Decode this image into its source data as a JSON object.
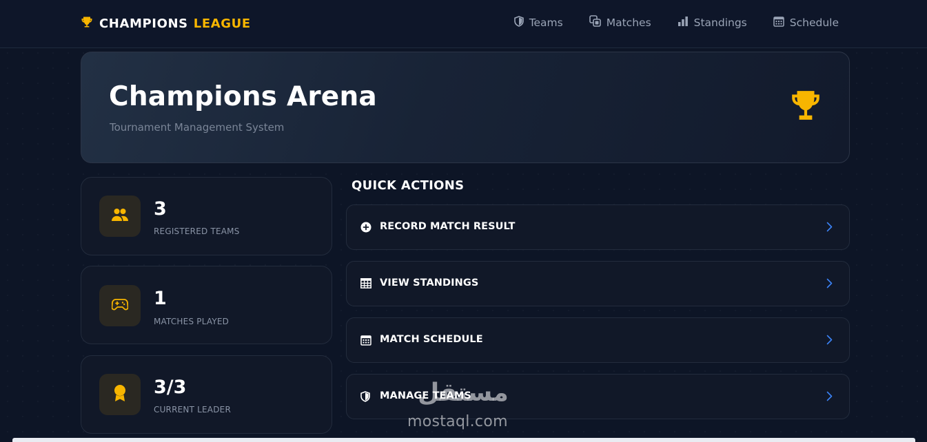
{
  "navbar": {
    "brand_primary": "CHAMPIONS",
    "brand_accent": "LEAGUE",
    "items": [
      {
        "label": "Teams",
        "icon": "shield-icon"
      },
      {
        "label": "Matches",
        "icon": "matches-icon"
      },
      {
        "label": "Standings",
        "icon": "bar-chart-icon"
      },
      {
        "label": "Schedule",
        "icon": "calendar-icon"
      }
    ]
  },
  "hero": {
    "title": "Champions Arena",
    "subtitle": "Tournament Management System",
    "icon": "trophy-icon"
  },
  "stats": [
    {
      "value": "3",
      "label": "REGISTERED TEAMS",
      "icon": "users-icon"
    },
    {
      "value": "1",
      "label": "MATCHES PLAYED",
      "icon": "gamepad-icon"
    },
    {
      "value": "3/3",
      "label": "CURRENT LEADER",
      "icon": "award-icon"
    }
  ],
  "quick_actions": {
    "title": "QUICK ACTIONS",
    "items": [
      {
        "label": "RECORD MATCH RESULT",
        "icon": "plus-circle-icon"
      },
      {
        "label": "VIEW STANDINGS",
        "icon": "table-icon"
      },
      {
        "label": "MATCH SCHEDULE",
        "icon": "calendar-icon"
      },
      {
        "label": "MANAGE TEAMS",
        "icon": "shield-icon"
      }
    ]
  },
  "watermark": {
    "logo": "مستقل",
    "text": "mostaql.com"
  },
  "colors": {
    "accent": "#f7b500",
    "background": "#0d1526",
    "card": "#111828",
    "chevron": "#3b82f6"
  }
}
